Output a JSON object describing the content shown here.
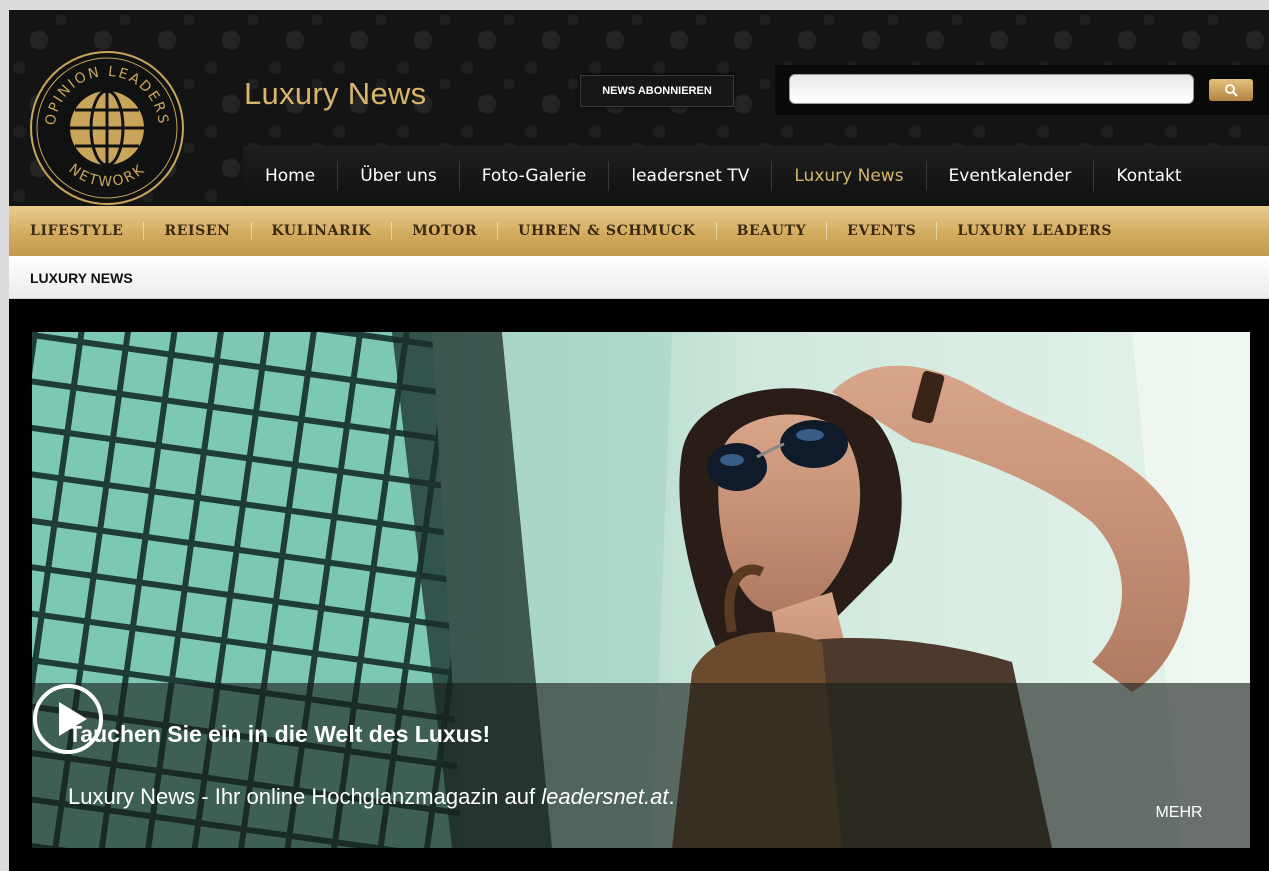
{
  "header": {
    "logo_text": "OPINION LEADERS NETWORK",
    "site_title": "Luxury News",
    "subscribe_label": "NEWS ABONNIEREN",
    "search_placeholder": ""
  },
  "main_nav": [
    {
      "label": "Home",
      "active": false
    },
    {
      "label": "Über uns",
      "active": false
    },
    {
      "label": "Foto-Galerie",
      "active": false
    },
    {
      "label": "leadersnet TV",
      "active": false
    },
    {
      "label": "Luxury News",
      "active": true
    },
    {
      "label": "Eventkalender",
      "active": false
    },
    {
      "label": "Kontakt",
      "active": false
    }
  ],
  "category_nav": [
    "LIFESTYLE",
    "REISEN",
    "KULINARIK",
    "MOTOR",
    "UHREN & SCHMUCK",
    "BEAUTY",
    "EVENTS",
    "LUXURY LEADERS"
  ],
  "breadcrumb": "LUXURY NEWS",
  "hero": {
    "title": "Tauchen Sie ein in die Welt des Luxus!",
    "text_prefix": "Luxury News - Ihr online Hochglanzmagazin auf ",
    "text_link": "leadersnet.at",
    "text_suffix": ".",
    "more_label": "MEHR"
  },
  "colors": {
    "gold": "#d7b56a",
    "category_bar": "#d2a95c",
    "background": "#000000"
  },
  "icons": [
    "globe-logo-icon",
    "search-icon",
    "play-icon"
  ]
}
